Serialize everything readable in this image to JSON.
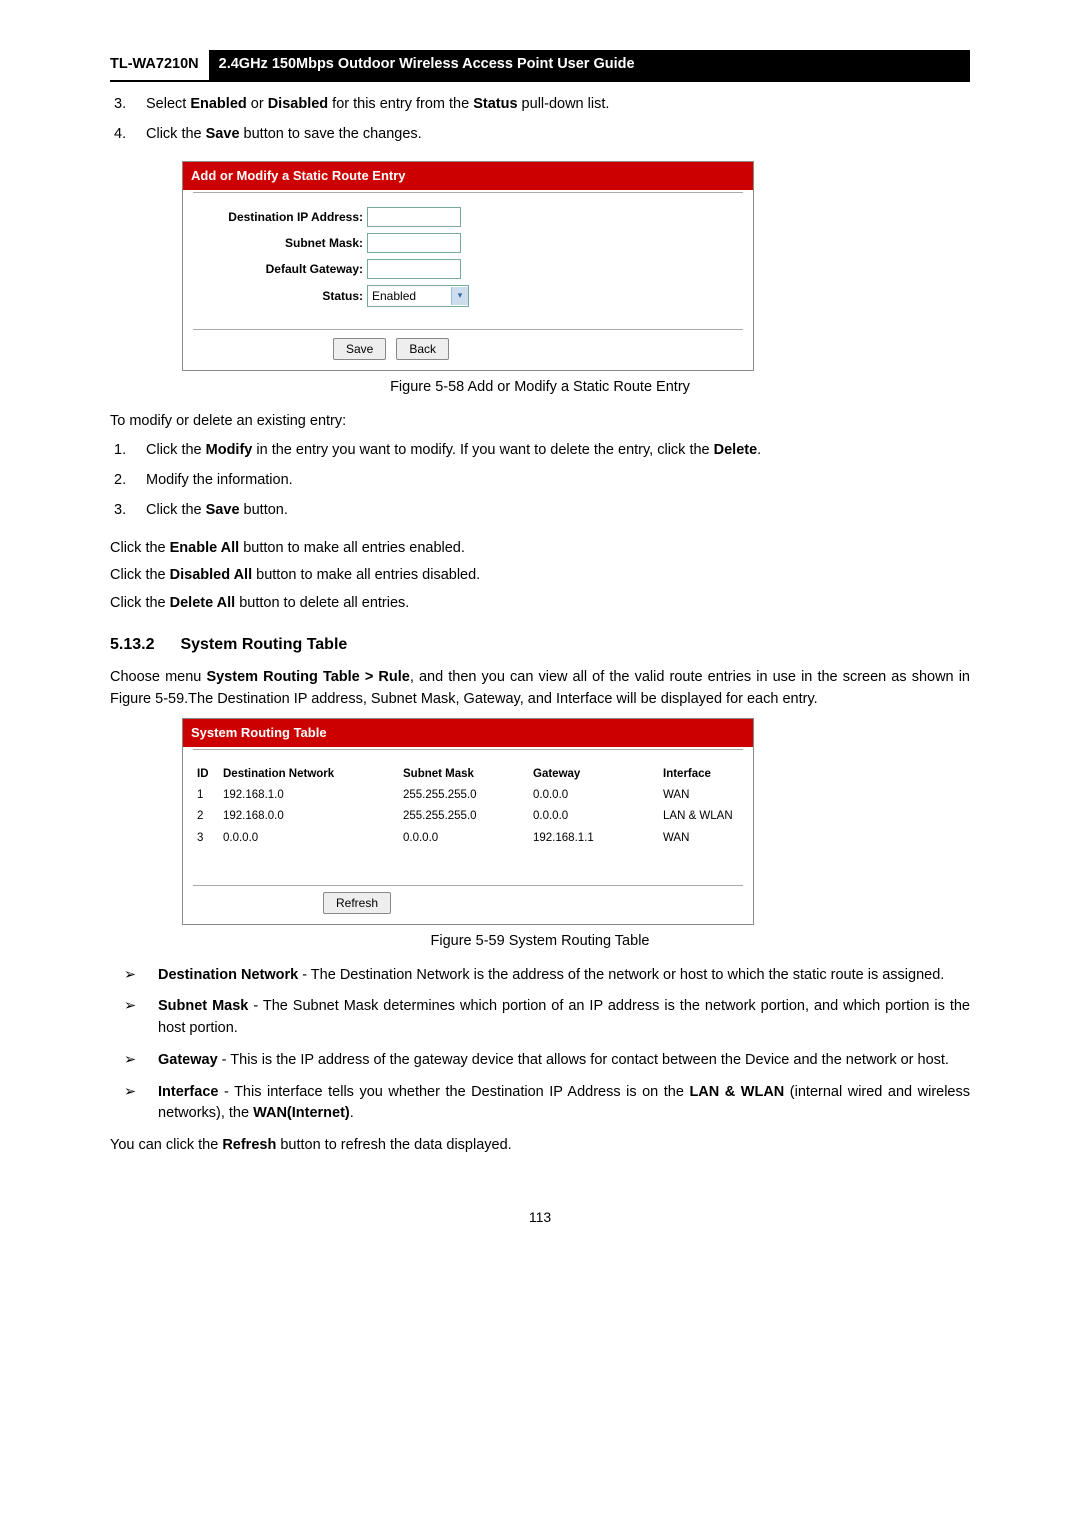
{
  "header": {
    "model": "TL-WA7210N",
    "title": "2.4GHz 150Mbps Outdoor Wireless Access Point User Guide"
  },
  "steps_top": [
    {
      "n": "3.",
      "pre": "Select ",
      "b1": "Enabled",
      "mid": " or ",
      "b2": "Disabled",
      "post": " for this entry from the ",
      "b3": "Status",
      "end": " pull-down list."
    },
    {
      "n": "4.",
      "pre": "Click the ",
      "b1": "Save",
      "post": " button to save the changes."
    }
  ],
  "fig58": {
    "title": "Add or Modify a Static Route Entry",
    "labels": {
      "dest": "Destination IP Address:",
      "mask": "Subnet Mask:",
      "gw": "Default Gateway:",
      "status": "Status:"
    },
    "status_value": "Enabled",
    "save": "Save",
    "back": "Back",
    "caption": "Figure 5-58 Add or Modify a Static Route Entry"
  },
  "modify_intro": "To modify or delete an existing entry:",
  "steps_mod": [
    {
      "n": "1.",
      "text_pre": "Click the ",
      "b1": "Modify",
      "text_mid": " in the entry you want to modify. If you want to delete the entry, click the ",
      "b2": "Delete",
      "text_end": "."
    },
    {
      "n": "2.",
      "text": "Modify the information."
    },
    {
      "n": "3.",
      "text_pre": "Click the ",
      "b1": "Save",
      "text_end": " button."
    }
  ],
  "click_lines": [
    {
      "pre": "Click the ",
      "b": "Enable All",
      "post": " button to make all entries enabled."
    },
    {
      "pre": "Click the ",
      "b": "Disabled All",
      "post": " button to make all entries disabled."
    },
    {
      "pre": "Click the ",
      "b": "Delete All",
      "post": " button to delete all entries."
    }
  ],
  "section": {
    "num": "5.13.2",
    "title": "System Routing Table"
  },
  "section_para": {
    "pre": "Choose menu ",
    "b1": "System Routing Table > Rule",
    "mid": ", and then you can view all of the valid route entries in use in the screen as shown in Figure 5-59.The Destination IP address, Subnet Mask, Gateway, and Interface will be displayed for each entry."
  },
  "fig59": {
    "title": "System Routing Table",
    "headers": {
      "id": "ID",
      "dn": "Destination Network",
      "sm": "Subnet Mask",
      "gw": "Gateway",
      "if": "Interface"
    },
    "rows": [
      {
        "id": "1",
        "dn": "192.168.1.0",
        "sm": "255.255.255.0",
        "gw": "0.0.0.0",
        "if": "WAN"
      },
      {
        "id": "2",
        "dn": "192.168.0.0",
        "sm": "255.255.255.0",
        "gw": "0.0.0.0",
        "if": "LAN & WLAN"
      },
      {
        "id": "3",
        "dn": "0.0.0.0",
        "sm": "0.0.0.0",
        "gw": "192.168.1.1",
        "if": "WAN"
      }
    ],
    "refresh": "Refresh",
    "caption": "Figure 5-59 System Routing Table"
  },
  "defs": [
    {
      "b": "Destination Network",
      "txt": " - The Destination Network is the address of the network or host to which the static route is assigned."
    },
    {
      "b": "Subnet Mask",
      "txt": " - The Subnet Mask determines which portion of an IP address is the network portion, and which portion is the host portion."
    },
    {
      "b": "Gateway",
      "txt": " - This is the IP address of the gateway device that allows for contact between the Device and the network or host."
    },
    {
      "b": "Interface",
      "pre": " - This interface tells you whether the Destination IP Address is on the ",
      "b2": "LAN & WLAN",
      "mid": " (internal wired and wireless networks), the ",
      "b3": "WAN(Internet)",
      "end": "."
    }
  ],
  "refresh_line": {
    "pre": "You can click the ",
    "b": "Refresh",
    "post": " button to refresh the data displayed."
  },
  "page_number": "113"
}
